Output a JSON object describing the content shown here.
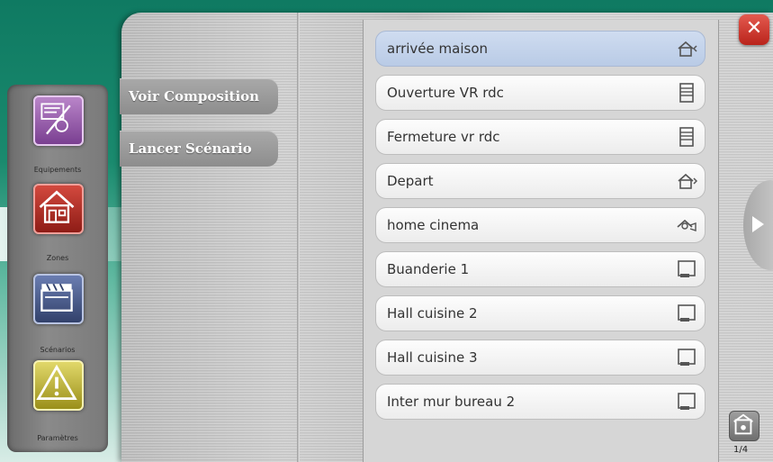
{
  "dock": {
    "items": [
      {
        "label": "Equipements",
        "icon": "equipment-icon"
      },
      {
        "label": "Zones",
        "icon": "house-zone-icon"
      },
      {
        "label": "Scénarios",
        "icon": "clapperboard-icon"
      },
      {
        "label": "Paramètres",
        "icon": "warning-icon"
      }
    ]
  },
  "menu": {
    "voir": "Voir Composition",
    "lancer": "Lancer Scénario"
  },
  "list": {
    "items": [
      {
        "label": "arrivée maison",
        "icon": "home-arrive-icon",
        "selected": true
      },
      {
        "label": "Ouverture VR rdc",
        "icon": "shutter-icon"
      },
      {
        "label": "Fermeture vr rdc",
        "icon": "shutter-icon"
      },
      {
        "label": "Depart",
        "icon": "home-leave-icon"
      },
      {
        "label": "home cinema",
        "icon": "cinema-icon"
      },
      {
        "label": "Buanderie 1",
        "icon": "switch-icon"
      },
      {
        "label": "Hall cuisine 2",
        "icon": "switch-icon"
      },
      {
        "label": "Hall cuisine 3",
        "icon": "switch-icon"
      },
      {
        "label": "Inter mur bureau 2",
        "icon": "switch-icon"
      }
    ]
  },
  "close_label": "✕",
  "page_indicator": "1/4",
  "colors": {
    "accent": "#b9231b",
    "selected": "#b9cbe6"
  }
}
